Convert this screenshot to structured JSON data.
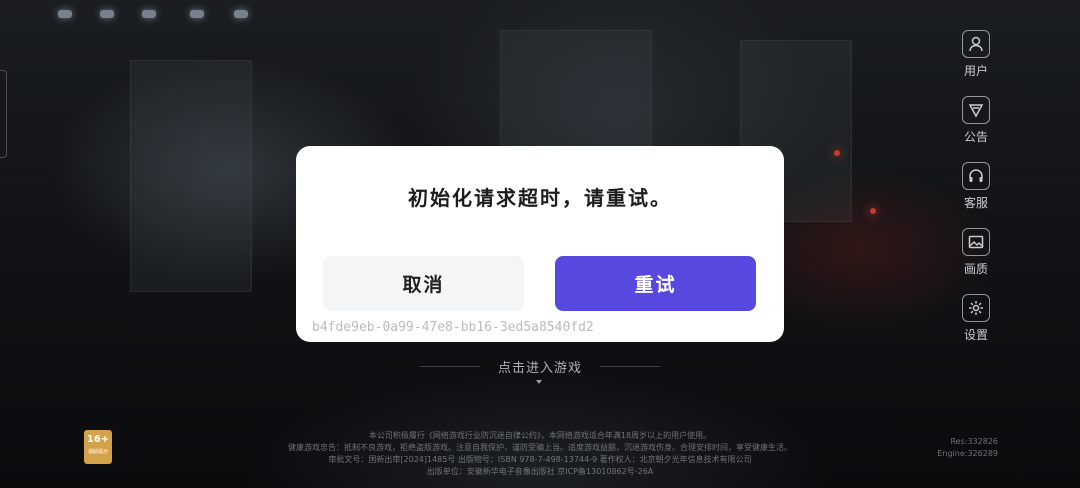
{
  "dialog": {
    "message": "初始化请求超时，请重试。",
    "cancel_label": "取消",
    "retry_label": "重试",
    "session_id": "b4fde9eb-0a99-47e8-bb16-3ed5a8540fd2"
  },
  "sidebar": {
    "items": [
      {
        "label": "用户",
        "icon": "user-icon"
      },
      {
        "label": "公告",
        "icon": "megaphone-icon"
      },
      {
        "label": "客服",
        "icon": "headset-icon"
      },
      {
        "label": "画质",
        "icon": "image-icon"
      },
      {
        "label": "设置",
        "icon": "gear-icon"
      }
    ]
  },
  "main": {
    "enter_game_label": "点击进入游戏"
  },
  "footer": {
    "age_rating": "16+",
    "age_rating_tag": "适龄提示",
    "lines": [
      "本公司积极履行《网络游戏行业防沉迷自律公约》，本网络游戏适合年满18周岁以上的用户使用。",
      "健康游戏忠告：抵制不良游戏，拒绝盗版游戏。注意自我保护，谨防受骗上当。适度游戏益脑，沉迷游戏伤身。合理安排时间，享受健康生活。",
      "审批文号：国新出审[2024]1485号 出版物号：ISBN 978-7-498-13744-9 著作权人：北京朝夕光年信息技术有限公司",
      "出版单位：安徽新华电子音像出版社 京ICP备13010862号-26A"
    ],
    "res_version": "Res:332826",
    "engine_version": "Engine:326289"
  },
  "colors": {
    "accent": "#5749e0",
    "dialog_bg": "#ffffff",
    "cancel_bg": "#f4f5f7"
  }
}
